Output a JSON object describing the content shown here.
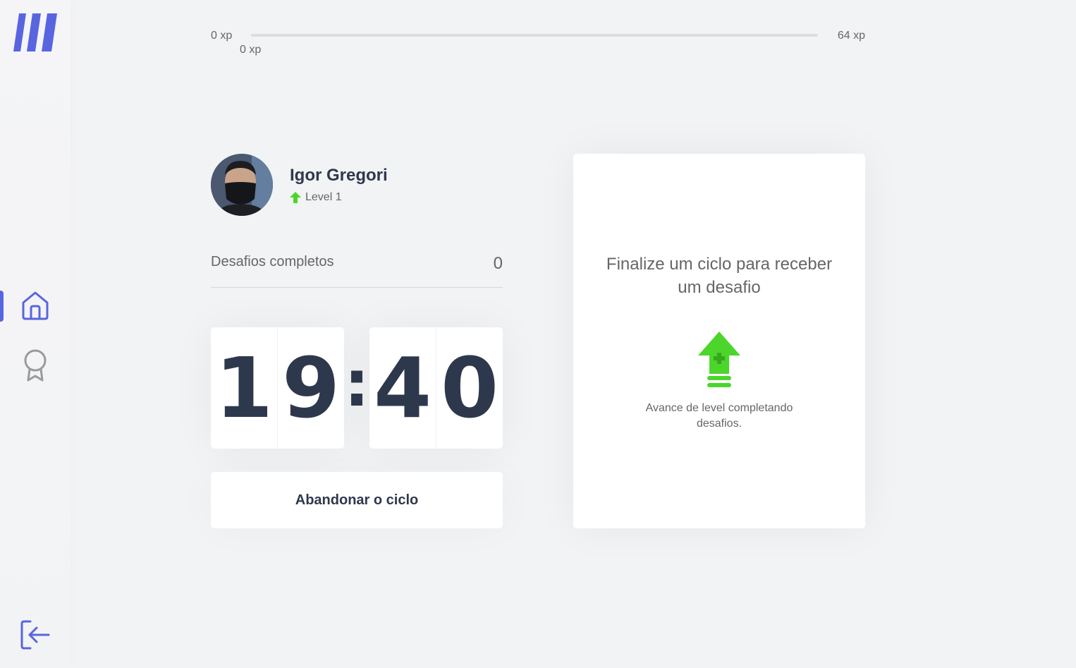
{
  "xp": {
    "min_label": "0 xp",
    "max_label": "64 xp",
    "current_label": "0 xp",
    "progress_fraction": 0
  },
  "profile": {
    "name": "Igor Gregori",
    "level_label": "Level 1"
  },
  "stats": {
    "completed_label": "Desafios completos",
    "completed_count": "0"
  },
  "countdown": {
    "minute_tens": "1",
    "minute_ones": "9",
    "separator": ":",
    "second_tens": "4",
    "second_ones": "0"
  },
  "cycle_button": {
    "label": "Abandonar o ciclo"
  },
  "challenge": {
    "title": "Finalize um ciclo para receber um desafio",
    "description": "Avance de level completando desafios."
  },
  "sidebar": {
    "items": [
      {
        "icon": "home-icon",
        "active": true
      },
      {
        "icon": "award-icon",
        "active": false
      }
    ],
    "logout_icon": "logout-icon"
  },
  "colors": {
    "accent": "#5965e0",
    "green": "#4cd62b",
    "title": "#2e384d",
    "text": "#666666",
    "background": "#f2f3f5"
  }
}
